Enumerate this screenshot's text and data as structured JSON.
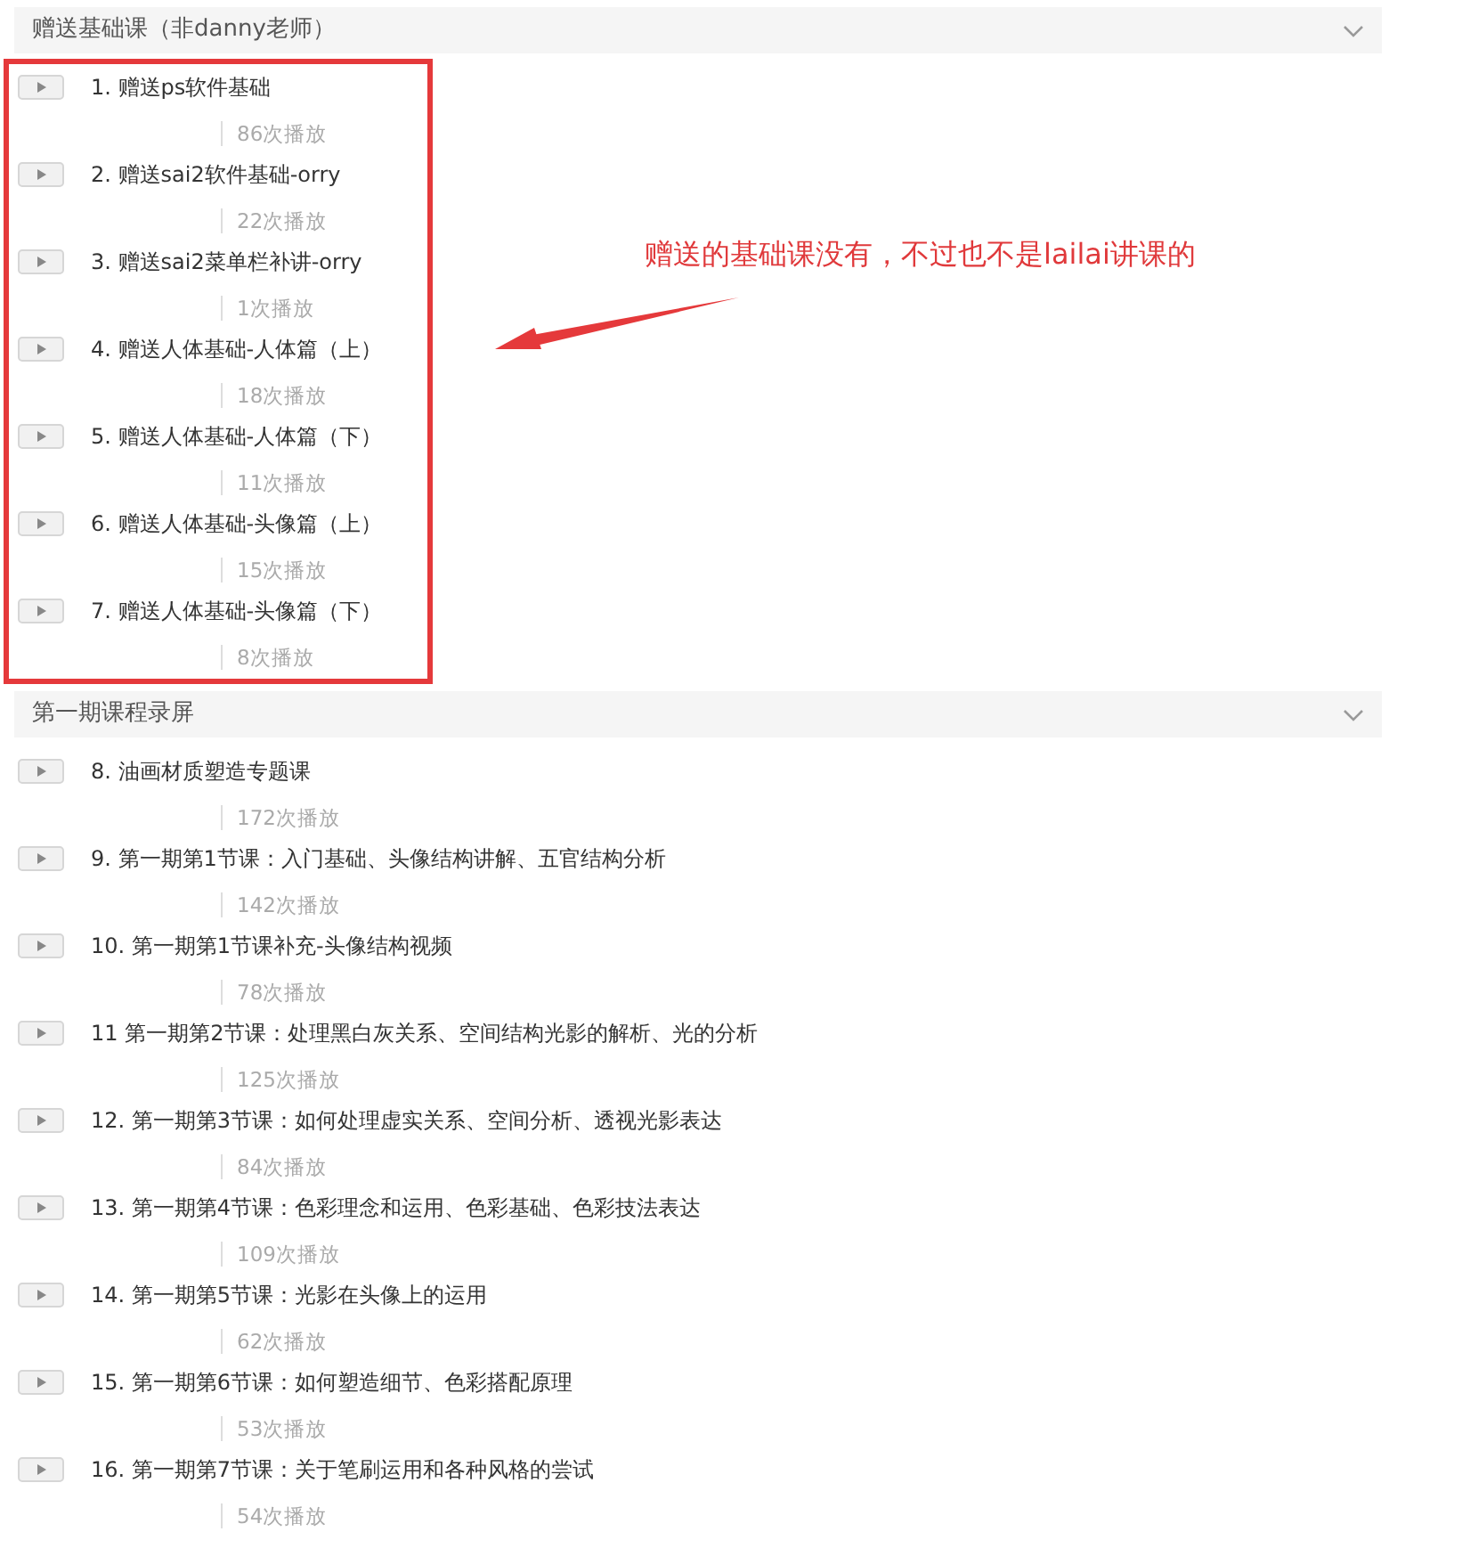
{
  "sections": [
    {
      "title": "赠送基础课（非danny老师）",
      "highlighted": true,
      "lessons": [
        {
          "title": "1. 赠送ps软件基础",
          "plays": "86次播放"
        },
        {
          "title": "2. 赠送sai2软件基础-orry",
          "plays": "22次播放"
        },
        {
          "title": "3. 赠送sai2菜单栏补讲-orry",
          "plays": "1次播放"
        },
        {
          "title": "4. 赠送人体基础-人体篇（上）",
          "plays": "18次播放"
        },
        {
          "title": "5. 赠送人体基础-人体篇（下）",
          "plays": "11次播放"
        },
        {
          "title": "6. 赠送人体基础-头像篇（上）",
          "plays": "15次播放"
        },
        {
          "title": "7. 赠送人体基础-头像篇（下）",
          "plays": "8次播放"
        }
      ]
    },
    {
      "title": "第一期课程录屏",
      "highlighted": false,
      "lessons": [
        {
          "title": "8. 油画材质塑造专题课",
          "plays": "172次播放"
        },
        {
          "title": "9. 第一期第1节课：入门基础、头像结构讲解、五官结构分析",
          "plays": "142次播放"
        },
        {
          "title": "10. 第一期第1节课补充-头像结构视频",
          "plays": "78次播放"
        },
        {
          "title": "11  第一期第2节课：处理黑白灰关系、空间结构光影的解析、光的分析",
          "plays": "125次播放"
        },
        {
          "title": "12. 第一期第3节课：如何处理虚实关系、空间分析、透视光影表达",
          "plays": "84次播放"
        },
        {
          "title": "13. 第一期第4节课：色彩理念和运用、色彩基础、色彩技法表达",
          "plays": "109次播放"
        },
        {
          "title": "14. 第一期第5节课：光影在头像上的运用",
          "plays": "62次播放"
        },
        {
          "title": "15. 第一期第6节课：如何塑造细节、色彩搭配原理",
          "plays": "53次播放"
        },
        {
          "title": "16. 第一期第7节课：关于笔刷运用和各种风格的尝试",
          "plays": "54次播放"
        }
      ]
    }
  ],
  "annotation": {
    "text": "赠送的基础课没有，不过也不是lailai讲课的"
  }
}
